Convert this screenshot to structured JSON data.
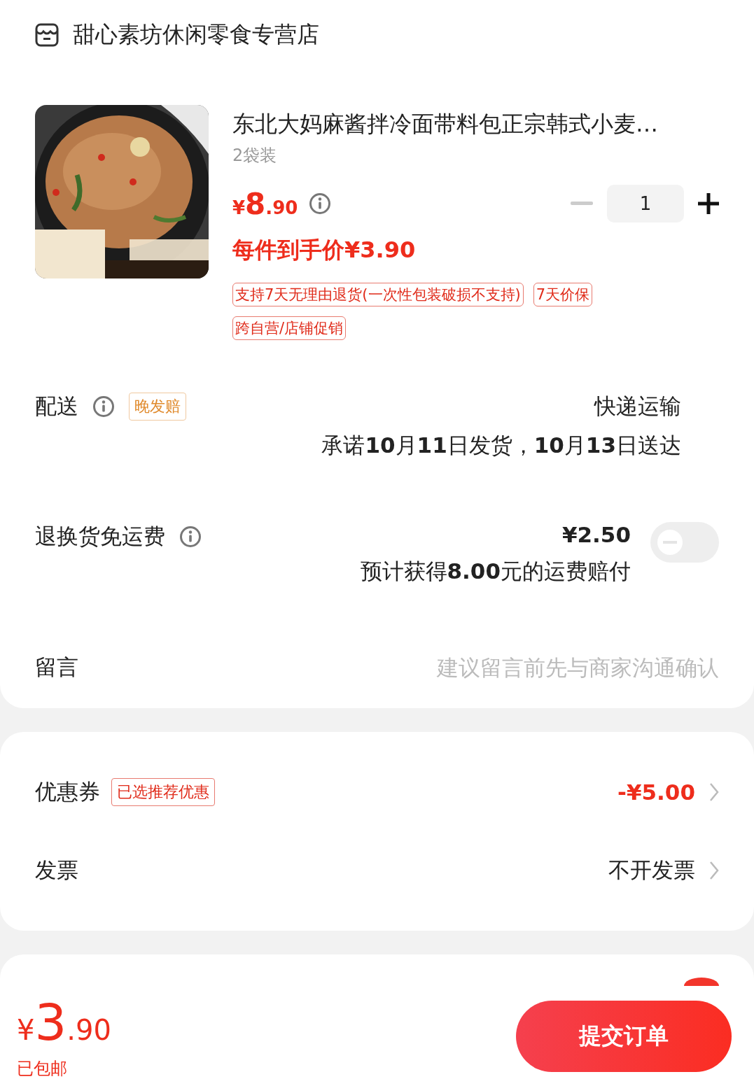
{
  "store": {
    "name": "甜心素坊休闲零食专营店"
  },
  "product": {
    "title": "东北大妈麻酱拌冷面带料包正宗韩式小麦…",
    "spec": "2袋装",
    "price": {
      "currency": "¥",
      "integer": "8",
      "decimal": ".90"
    },
    "final_price": "每件到手价¥3.90",
    "quantity": "1",
    "minus_disabled": true,
    "tags": [
      "支持7天无理由退货(一次性包装破损不支持)",
      "7天价保",
      "跨自营/店铺促销"
    ]
  },
  "delivery": {
    "label": "配送",
    "badge": "晚发赔",
    "method": "快递运输",
    "promise": "承诺**10**月**11**日发货，**10**月**13**日送达"
  },
  "return_insurance": {
    "label": "退换货免运费",
    "price": "¥2.50",
    "note": "预计获得**8.00**元的运费赔付",
    "on": false
  },
  "message": {
    "label": "留言",
    "placeholder": "建议留言前先与商家沟通确认"
  },
  "coupon": {
    "label": "优惠券",
    "badge": "已选推荐优惠",
    "value": "-¥5.00"
  },
  "invoice": {
    "label": "发票",
    "value": "不开发票"
  },
  "bottom_bar": {
    "total": {
      "currency": "¥",
      "integer": "3",
      "decimal": ".90"
    },
    "shipping": "已包邮",
    "submit": "提交订单"
  }
}
